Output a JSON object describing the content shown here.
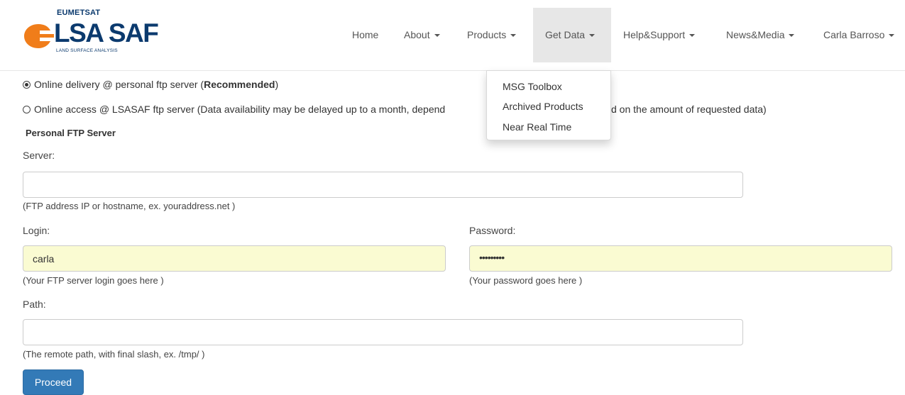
{
  "brand": {
    "org": "EUMETSAT",
    "name": "LSA SAF",
    "tagline": "LAND SURFACE ANALYSIS"
  },
  "nav": {
    "home": "Home",
    "about": "About",
    "products": "Products",
    "get_data": "Get Data",
    "help_support": "Help&Support",
    "news_media": "News&Media",
    "user": "Carla Barroso"
  },
  "dropdown": {
    "items": [
      "MSG Toolbox",
      "Archived Products",
      "Near Real Time"
    ]
  },
  "delivery": {
    "option1_prefix": "Online delivery @ personal ftp server (",
    "option1_bold": "Recommended",
    "option1_suffix": ")",
    "option2_left": "Online access @ LSASAF ftp server (Data availability may be delayed up to a month, depend",
    "option2_right": "d on the amount of requested data)"
  },
  "form": {
    "section_title": "Personal FTP Server",
    "server_label": "Server:",
    "server_value": "",
    "server_help": "(FTP address IP or hostname, ex. youraddress.net )",
    "login_label": "Login:",
    "login_value": "carla",
    "login_help": "(Your FTP server login goes here )",
    "password_label": "Password:",
    "password_value": "•••••••••",
    "password_help": "(Your password goes here )",
    "path_label": "Path:",
    "path_value": "",
    "path_help": "(The remote path, with final slash, ex. /tmp/ )",
    "proceed_label": "Proceed"
  },
  "colors": {
    "brand_navy": "#0b3a6e",
    "brand_orange": "#f07d1a",
    "primary_button": "#337ab7",
    "autofill": "#fafbd2"
  }
}
